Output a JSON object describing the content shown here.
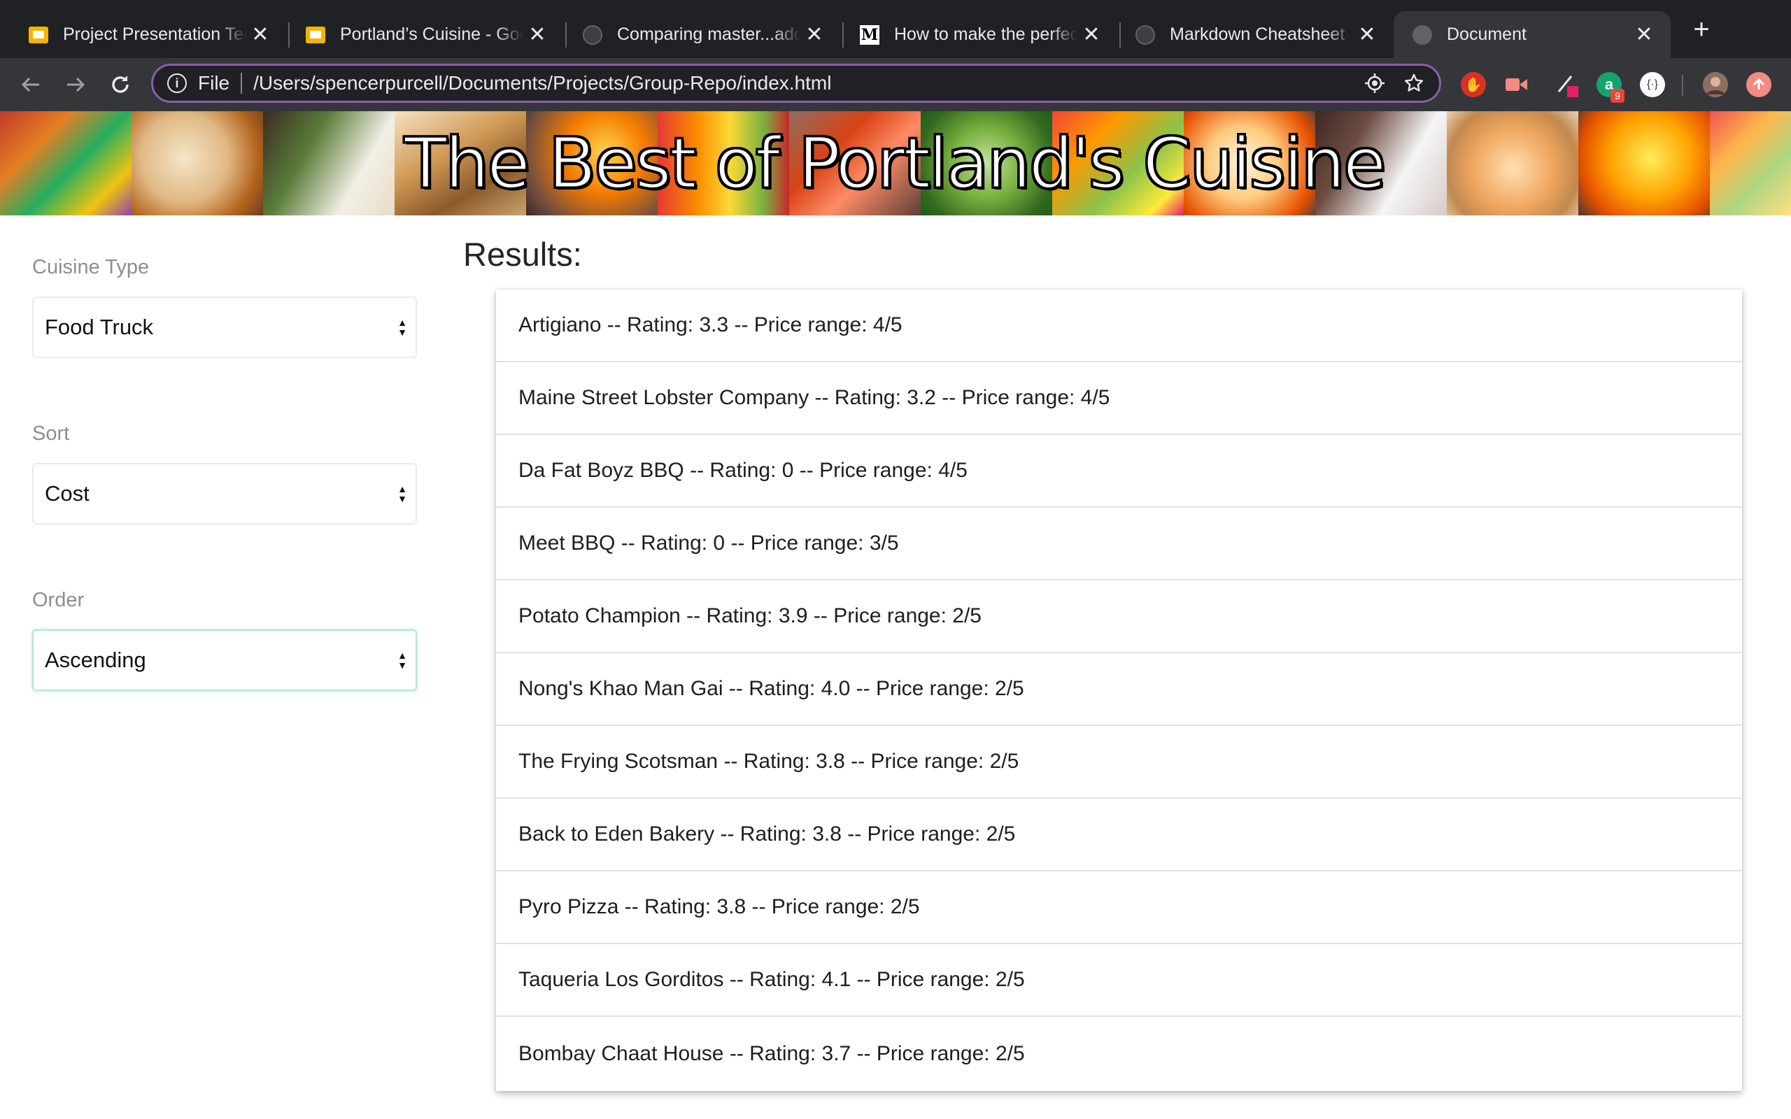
{
  "browser": {
    "tabs": [
      {
        "title": "Project Presentation Template",
        "favicon": "slides-icon"
      },
      {
        "title": "Portland’s Cuisine - Google Slides",
        "favicon": "slides-icon"
      },
      {
        "title": "Comparing master...add-",
        "favicon": "github-icon"
      },
      {
        "title": "How to make the perfect",
        "favicon": "medium-icon"
      },
      {
        "title": "Markdown Cheatsheet · ",
        "favicon": "github-icon"
      },
      {
        "title": "Document",
        "favicon": "globe-icon",
        "active": true
      }
    ],
    "new_tab_symbol": "+",
    "close_symbol": "✕",
    "address": {
      "scheme_label": "File",
      "url": "/Users/spencerpurcell/Documents/Projects/Group-Repo/index.html"
    },
    "extension_badge": "9"
  },
  "banner": {
    "title": "The Best of Portland's Cuisine"
  },
  "filters": {
    "cuisine": {
      "label": "Cuisine Type",
      "value": "Food Truck"
    },
    "sort": {
      "label": "Sort",
      "value": "Cost"
    },
    "order": {
      "label": "Order",
      "value": "Ascending"
    }
  },
  "results": {
    "heading": "Results:",
    "items": [
      "Artigiano -- Rating: 3.3 -- Price range: 4/5",
      "Maine Street Lobster Company -- Rating: 3.2 -- Price range: 4/5",
      "Da Fat Boyz BBQ -- Rating: 0 -- Price range: 4/5",
      "Meet BBQ -- Rating: 0 -- Price range: 3/5",
      "Potato Champion -- Rating: 3.9 -- Price range: 2/5",
      "Nong's Khao Man Gai -- Rating: 4.0 -- Price range: 2/5",
      "The Frying Scotsman -- Rating: 3.8 -- Price range: 2/5",
      "Back to Eden Bakery -- Rating: 3.8 -- Price range: 2/5",
      "Pyro Pizza -- Rating: 3.8 -- Price range: 2/5",
      "Taqueria Los Gorditos -- Rating: 4.1 -- Price range: 2/5",
      "Bombay Chaat House -- Rating: 3.7 -- Price range: 2/5"
    ]
  },
  "colors": {
    "tabstrip": "#202124",
    "toolbar": "#35363a",
    "omnibox_border": "#8a5ea8",
    "focus_border": "#b7e4db"
  }
}
